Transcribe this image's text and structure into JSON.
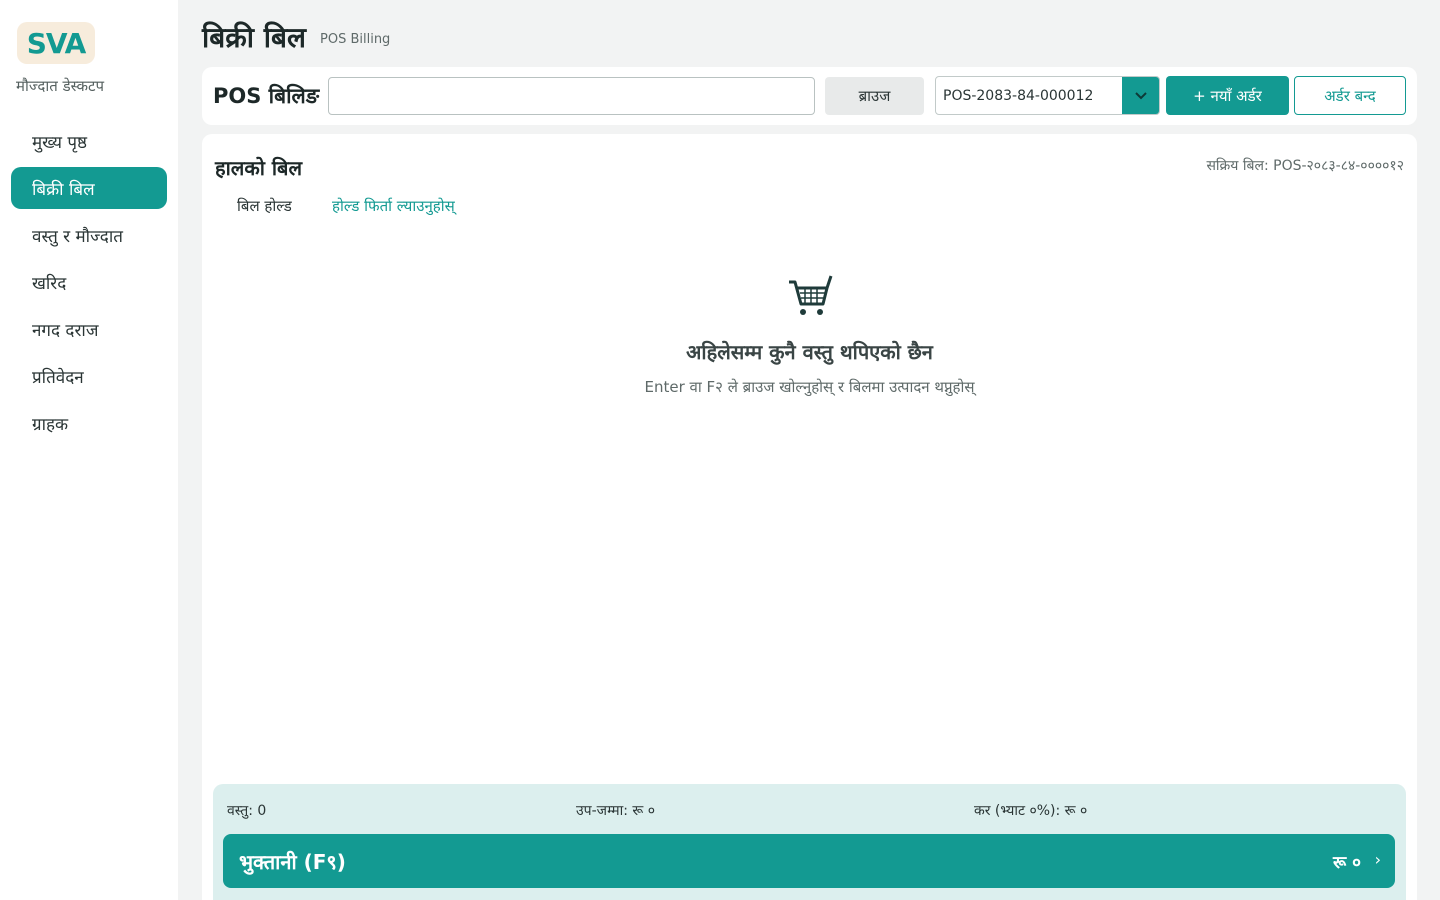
{
  "app": {
    "logo_text": "SVA",
    "subtitle": "मौज्दात डेस्कटप"
  },
  "sidebar": {
    "items": [
      {
        "label": "मुख्य पृष्ठ",
        "active": false
      },
      {
        "label": "बिक्री बिल",
        "active": true
      },
      {
        "label": "वस्तु र मौज्दात",
        "active": false
      },
      {
        "label": "खरिद",
        "active": false
      },
      {
        "label": "नगद दराज",
        "active": false
      },
      {
        "label": "प्रतिवेदन",
        "active": false
      },
      {
        "label": "ग्राहक",
        "active": false
      }
    ]
  },
  "header": {
    "title": "बिक्री बिल",
    "subtitle": "POS Billing"
  },
  "toolbar": {
    "label": "POS बिलिङ",
    "search_value": "",
    "search_placeholder": "",
    "browse_label": "ब्राउज",
    "order_selected": "POS-2083-84-000012",
    "new_order_label": "+ नयाँ अर्डर",
    "close_order_label": "अर्डर बन्द"
  },
  "bill": {
    "title": "हालको बिल",
    "active_bill": "सक्रिय बिल: POS-२०८३-८४-००००१२",
    "hold_label": "बिल होल्ड",
    "recall_label": "होल्ड फिर्ता ल्याउनुहोस्",
    "empty_title": "अहिलेसम्म कुनै वस्तु थपिएको छैन",
    "empty_desc": "Enter वा F२ ले ब्राउज खोल्नुहोस् र बिलमा उत्पादन थप्नुहोस्"
  },
  "summary": {
    "items": "वस्तु: 0",
    "subtotal": "उप-जम्मा: रू ०",
    "tax": "कर (भ्याट ०%): रू ०",
    "pay_label": "भुक्तानी (F९)",
    "pay_amount": "रू ०",
    "pay_arrow": "›"
  },
  "colors": {
    "accent": "#139a92",
    "summary_bg": "#dcefee",
    "page_bg": "#f2f3f3"
  }
}
